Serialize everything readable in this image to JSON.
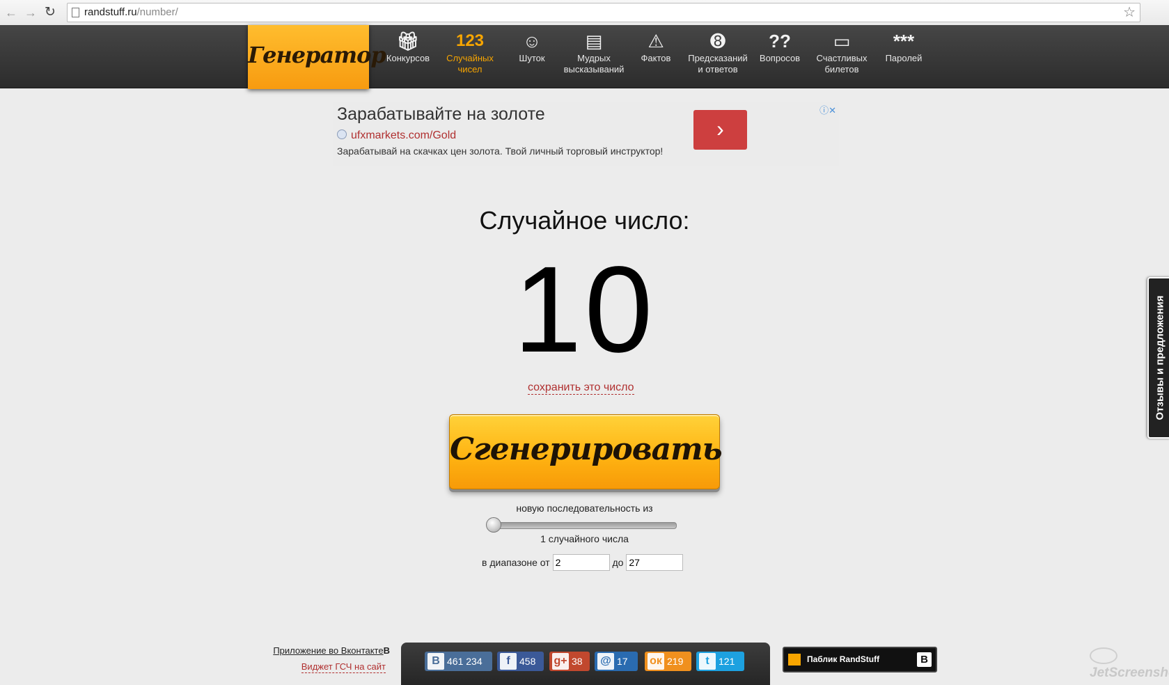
{
  "browser": {
    "url_host": "randstuff.ru",
    "url_path": "/number/"
  },
  "site": {
    "logo": "Генератор",
    "nav": [
      {
        "icon": "gift",
        "label": "Конкурсов"
      },
      {
        "icon": "123",
        "label": "Случайных чисел"
      },
      {
        "icon": "smiley",
        "label": "Шуток"
      },
      {
        "icon": "scroll",
        "label": "Мудрых высказываний"
      },
      {
        "icon": "exclamation",
        "label": "Фактов"
      },
      {
        "icon": "8-ball",
        "label": "Предсказаний и ответов"
      },
      {
        "icon": "question-marks",
        "label": "Вопросов"
      },
      {
        "icon": "ticket",
        "label": "Счастливых билетов"
      },
      {
        "icon": "asterisks",
        "label": "Паролей"
      }
    ],
    "nav_active_index": 1
  },
  "ad": {
    "title": "Зарабатывайте на золоте",
    "url": "ufxmarkets.com/Gold",
    "description": "Зарабатывай на скачках цен золота. Твой личный торговый инструктор!",
    "button_glyph": "›"
  },
  "main": {
    "result_label": "Случайное число:",
    "result_value": "10",
    "save_link": "сохранить это число",
    "generate_button": "Сгенерировать",
    "sequence_label": "новую последовательность из",
    "count_label": "1 случайного числа",
    "count_slider_fraction": 0,
    "range_from_label": "в диапазоне от",
    "range_from_value": "2",
    "range_to_label": "до",
    "range_to_value": "27"
  },
  "feedback_tab": "Отзывы и предложения",
  "footer": {
    "vk_app_link": "Приложение во Вконтакте",
    "vk_badge": "B",
    "widget_link": "Виджет ГСЧ на сайт",
    "shares": [
      {
        "network": "vk",
        "icon": "B",
        "count": "461 234",
        "color": "#4a6e99"
      },
      {
        "network": "facebook",
        "icon": "f",
        "count": "458",
        "color": "#3b5998"
      },
      {
        "network": "google-plus",
        "icon": "g+",
        "count": "38",
        "color": "#c1482e"
      },
      {
        "network": "mail",
        "icon": "@",
        "count": "17",
        "color": "#2a6bb0"
      },
      {
        "network": "odnoklassniki",
        "icon": "ок",
        "count": "219",
        "color": "#f0901e"
      },
      {
        "network": "twitter",
        "icon": "t",
        "count": "121",
        "color": "#1da1e0"
      }
    ],
    "vk_group": "Паблик RandStuff",
    "vk_group_badge": "B"
  },
  "watermark": "JetScreenshot",
  "colors": {
    "accent": "#f7a500",
    "link_red": "#b03030",
    "nav_bg": "#353535"
  }
}
